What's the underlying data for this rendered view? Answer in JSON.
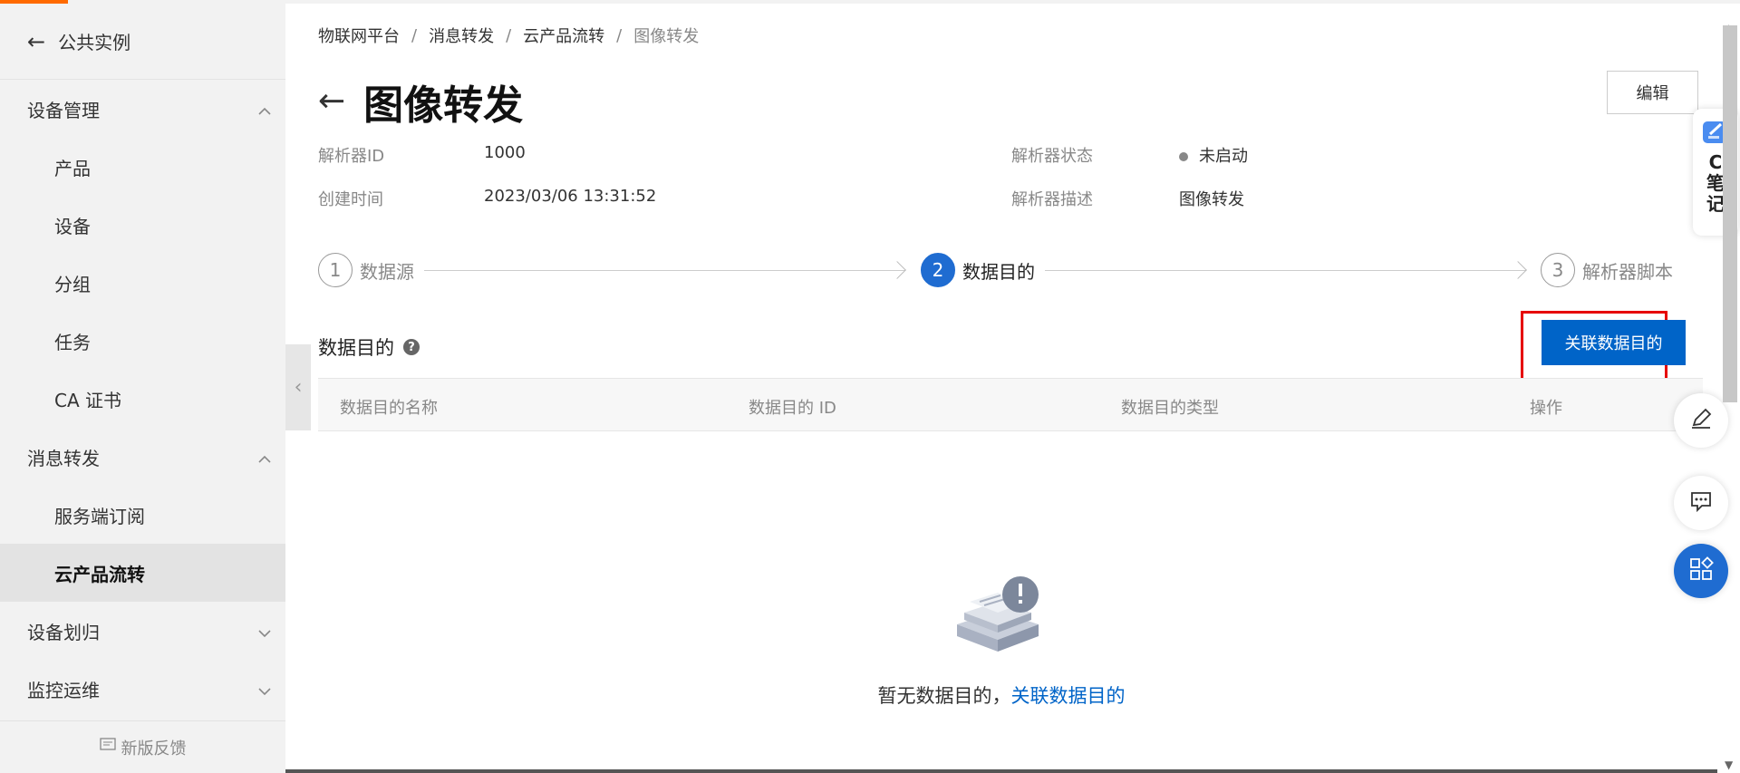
{
  "sidebar": {
    "back_label": "公共实例",
    "groups": [
      {
        "label": "设备管理",
        "expanded": true,
        "items": [
          {
            "label": "产品"
          },
          {
            "label": "设备"
          },
          {
            "label": "分组"
          },
          {
            "label": "任务"
          },
          {
            "label": "CA 证书"
          }
        ]
      },
      {
        "label": "消息转发",
        "expanded": true,
        "items": [
          {
            "label": "服务端订阅"
          },
          {
            "label": "云产品流转",
            "active": true
          }
        ]
      },
      {
        "label": "设备划归",
        "expanded": false
      },
      {
        "label": "监控运维",
        "expanded": false
      }
    ],
    "feedback_label": "新版反馈"
  },
  "breadcrumb": [
    "物联网平台",
    "消息转发",
    "云产品流转",
    "图像转发"
  ],
  "breadcrumb_sep": "/",
  "page": {
    "title": "图像转发",
    "edit_label": "编辑",
    "info": {
      "parser_id_label": "解析器ID",
      "parser_id": "1000",
      "created_label": "创建时间",
      "created": "2023/03/06 13:31:52",
      "status_label": "解析器状态",
      "status": "未启动",
      "desc_label": "解析器描述",
      "desc": "图像转发"
    }
  },
  "steps": [
    {
      "num": "1",
      "label": "数据源",
      "active": false
    },
    {
      "num": "2",
      "label": "数据目的",
      "active": true
    },
    {
      "num": "3",
      "label": "解析器脚本",
      "active": false
    }
  ],
  "section": {
    "title": "数据目的",
    "help": "?",
    "link_button": "关联数据目的",
    "columns": [
      "数据目的名称",
      "数据目的 ID",
      "数据目的类型",
      "操作"
    ],
    "empty_text": "暂无数据目的，",
    "empty_link": "关联数据目的"
  },
  "note_widget": {
    "label_c": "C",
    "label_1": "笔",
    "label_2": "记"
  },
  "colors": {
    "primary": "#0064c8",
    "step_active": "#1f6cd1",
    "highlight": "#e60000"
  }
}
